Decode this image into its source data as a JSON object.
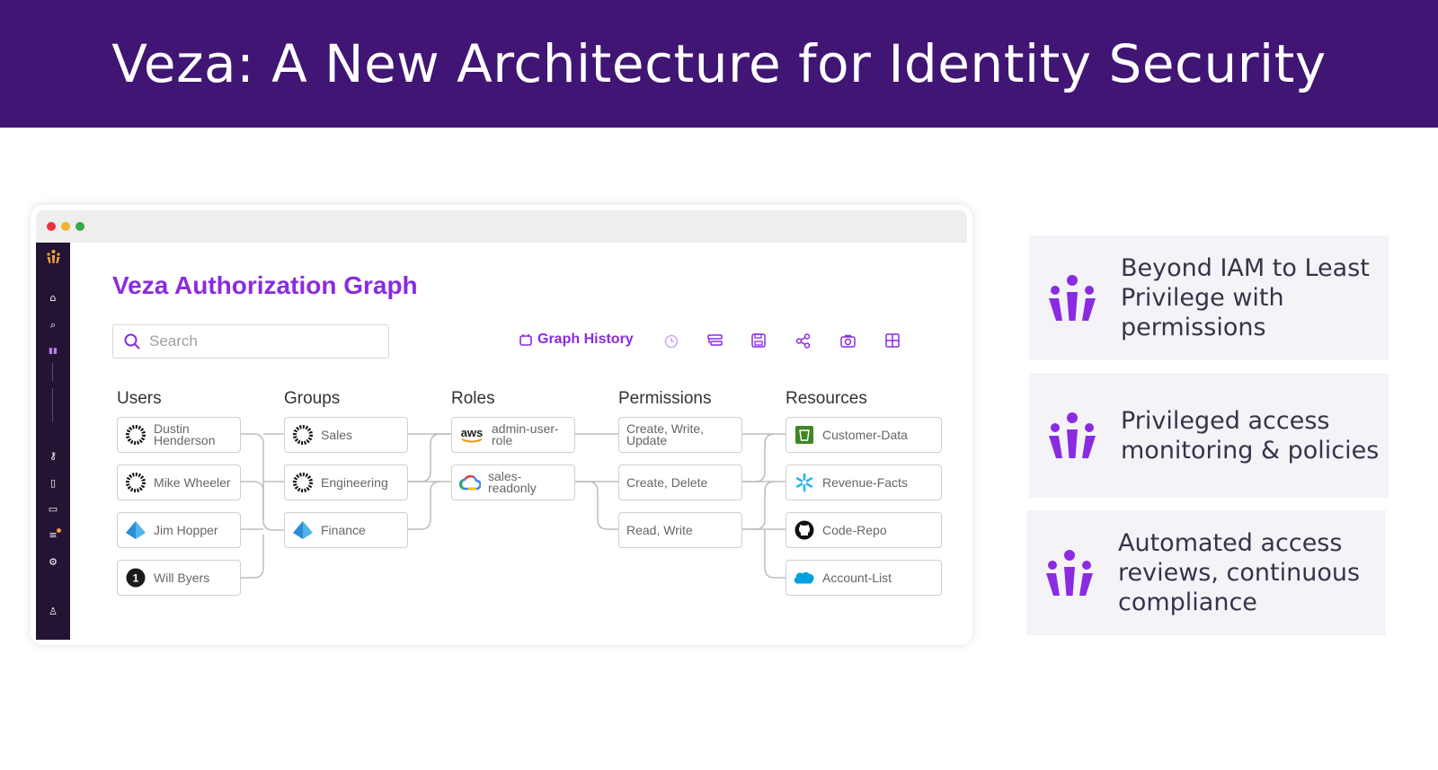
{
  "slide": {
    "title": "Veza: A New Architecture for Identity Security"
  },
  "app": {
    "title": "Veza Authorization Graph",
    "search_placeholder": "Search",
    "toolbar": {
      "graph_history_label": "Graph History"
    },
    "columns": [
      "Users",
      "Groups",
      "Roles",
      "Permissions",
      "Resources"
    ],
    "users": [
      "Dustin Henderson",
      "Mike Wheeler",
      "Jim Hopper",
      "Will Byers"
    ],
    "groups": [
      "Sales",
      "Engineering",
      "Finance"
    ],
    "roles": [
      "admin-user-role",
      "sales-readonly"
    ],
    "permissions": [
      "Create, Write, Update",
      "Create, Delete",
      "Read, Write"
    ],
    "resources": [
      "Customer-Data",
      "Revenue-Facts",
      "Code-Repo",
      "Account-List"
    ],
    "role_logo_text": "aws"
  },
  "cards": [
    {
      "text": "Beyond IAM to Least Privilege with permissions"
    },
    {
      "text": "Privileged access monitoring & policies"
    },
    {
      "text": "Automated access reviews, continuous compliance"
    }
  ],
  "colors": {
    "banner": "#401573",
    "accent": "#8a2be2",
    "sidebar": "#241433",
    "card_bg": "#f4f3f8"
  }
}
